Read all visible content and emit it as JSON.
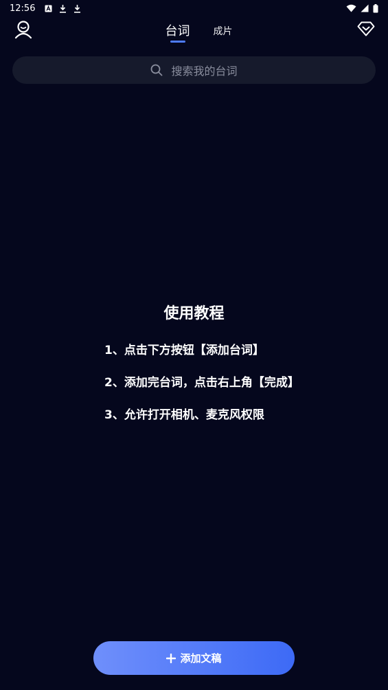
{
  "status_bar": {
    "time": "12:56",
    "left_icons": [
      "font-icon",
      "download-icon",
      "download-icon"
    ],
    "right_icons": [
      "wifi-icon",
      "signal-icon",
      "battery-icon"
    ]
  },
  "header": {
    "profile_icon": "user-icon",
    "vip_icon": "diamond-icon",
    "tabs": [
      {
        "label": "台词",
        "active": true
      },
      {
        "label": "成片",
        "active": false
      }
    ]
  },
  "search": {
    "placeholder": "搜索我的台词"
  },
  "tutorial": {
    "title": "使用教程",
    "steps": [
      "1、点击下方按钮【添加台词】",
      "2、添加完台词，点击右上角【完成】",
      "3、允许打开相机、麦克风权限"
    ]
  },
  "add_button": {
    "label": "添加文稿"
  },
  "colors": {
    "background": "#05071d",
    "search_background": "#161a2c",
    "accent": "#4e7cff",
    "button_gradient_start": "#6f8ffb",
    "button_gradient_end": "#3d6af6"
  }
}
